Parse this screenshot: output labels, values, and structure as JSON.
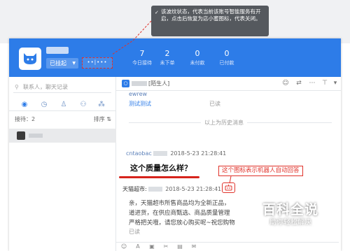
{
  "annotation_top": {
    "text": "该波纹状态，代表当前该账号智能服务有开启，点击后恢复为店小蜜图标，代表关闭。"
  },
  "header": {
    "status_label": "已挂起",
    "dots": "••|•••",
    "stats": [
      {
        "value": "7",
        "label": "今日接待"
      },
      {
        "value": "2",
        "label": "未下单"
      },
      {
        "value": "0",
        "label": "未付款"
      },
      {
        "value": "0",
        "label": "已付款"
      }
    ]
  },
  "left": {
    "search_placeholder": "联系人，聊天记录",
    "rank_label": "接待：2",
    "sort_label": "排序 ⇅"
  },
  "chat": {
    "title": "[陌生人]",
    "first_msg_sender": "ewrew",
    "first_msg_text": "测试测试",
    "first_msg_status": "已读",
    "history_label": "以上为历史消息",
    "customer_sender": "cntaobac",
    "customer_time": "2018-5-23 21:28:41",
    "customer_question": "这个质量怎么样？",
    "robot_annotation": "这个图标表示机器人自动回答",
    "shop_sender": "天猫超市:",
    "shop_time": "2018-5-23 21:28:41",
    "reply_lines": [
      "亲，天猫超市所售商品均为全新正品，",
      "道进货，在供应商甄选、商品质量管理",
      "严格把关哦，请您放心购买呢~祝您购物"
    ],
    "reply_status": "已读"
  },
  "watermark": {
    "big": "百科全说",
    "small": "助你轻松解决"
  }
}
